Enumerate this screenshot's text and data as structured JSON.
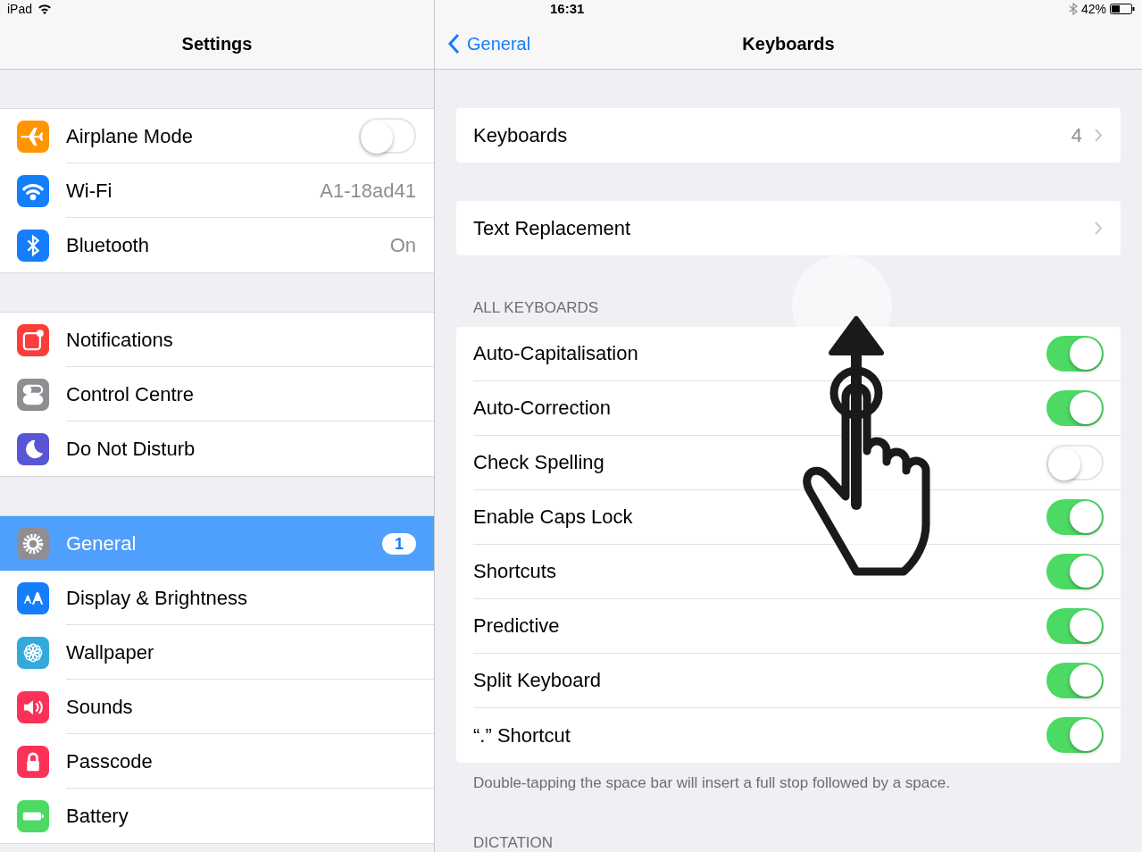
{
  "status_bar": {
    "device": "iPad",
    "time": "16:31",
    "battery": "42%"
  },
  "sidebar": {
    "title": "Settings",
    "groups": [
      [
        {
          "color": "#ff9500",
          "label": "Airplane Mode",
          "kind": "toggle",
          "on": false,
          "selected": false
        },
        {
          "color": "#147efb",
          "label": "Wi-Fi",
          "kind": "value",
          "value": "A1-18ad41",
          "selected": false
        },
        {
          "color": "#147efb",
          "label": "Bluetooth",
          "kind": "value",
          "value": "On",
          "selected": false
        }
      ],
      [
        {
          "color": "#fc3d39",
          "label": "Notifications",
          "kind": "plain",
          "selected": false
        },
        {
          "color": "#8e8e93",
          "label": "Control Centre",
          "kind": "plain",
          "selected": false
        },
        {
          "color": "#5856d6",
          "label": "Do Not Disturb",
          "kind": "plain",
          "selected": false
        }
      ],
      [
        {
          "color": "#8e8e93",
          "label": "General",
          "kind": "badge",
          "badge": "1",
          "selected": true
        },
        {
          "color": "#147efb",
          "label": "Display & Brightness",
          "kind": "plain",
          "selected": false
        },
        {
          "color": "#34aadc",
          "label": "Wallpaper",
          "kind": "plain",
          "selected": false
        },
        {
          "color": "#fc3158",
          "label": "Sounds",
          "kind": "plain",
          "selected": false
        },
        {
          "color": "#fc3158",
          "label": "Passcode",
          "kind": "plain",
          "selected": false
        },
        {
          "color": "#4cd964",
          "label": "Battery",
          "kind": "plain",
          "selected": false
        }
      ]
    ]
  },
  "detail": {
    "back": "General",
    "title": "Keyboards",
    "links": [
      {
        "label": "Keyboards",
        "value": "4"
      },
      {
        "label": "Text Replacement"
      }
    ],
    "section_header": "ALL KEYBOARDS",
    "toggles": [
      {
        "label": "Auto-Capitalisation",
        "on": true
      },
      {
        "label": "Auto-Correction",
        "on": true
      },
      {
        "label": "Check Spelling",
        "on": false
      },
      {
        "label": "Enable Caps Lock",
        "on": true
      },
      {
        "label": "Shortcuts",
        "on": true
      },
      {
        "label": "Predictive",
        "on": true
      },
      {
        "label": "Split Keyboard",
        "on": true
      },
      {
        "label": "“.” Shortcut",
        "on": true
      }
    ],
    "footer": "Double-tapping the space bar will insert a full stop followed by a space.",
    "next_header": "DICTATION"
  }
}
